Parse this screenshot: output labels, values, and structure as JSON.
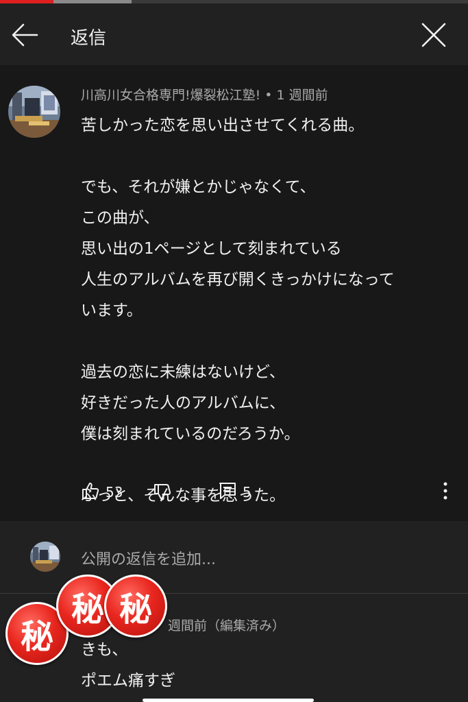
{
  "header": {
    "title": "返信"
  },
  "comment": {
    "author": "川高川女合格専門!爆裂松江塾!",
    "separator": "•",
    "time": "1 週間前",
    "paragraphs": [
      [
        "苦しかった恋を思い出させてくれる曲。"
      ],
      [
        "でも、それが嫌とかじゃなくて、",
        "この曲が、",
        "思い出の1ページとして刻まれている",
        "人生のアルバムを再び開くきっかけになって",
        "います。"
      ],
      [
        "過去の恋に未練はないけど、",
        "好きだった人のアルバムに、",
        "僕は刻まれているのだろうか。"
      ],
      [
        "ふっと、そんな事を思った。"
      ]
    ],
    "likes": "53",
    "replies": "5"
  },
  "reply_input": {
    "placeholder": "公開の返信を追加..."
  },
  "reply": {
    "meta": "週間前（編集済み）",
    "lines": [
      "きも、",
      "ポエム痛すぎ"
    ]
  },
  "stamps": {
    "text": "秘",
    "color": "#e8261e"
  },
  "colors": {
    "accent": "#e02020",
    "background": "#212121",
    "panel": "#181818",
    "muted": "#aaaaaa"
  },
  "progress": {
    "played_fraction": 0.114,
    "buffered_fraction": 0.281
  }
}
